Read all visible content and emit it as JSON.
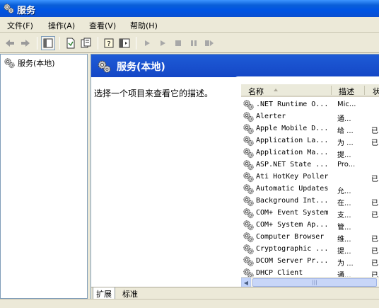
{
  "window": {
    "title": "服务"
  },
  "menu": [
    "文件(F)",
    "操作(A)",
    "查看(V)",
    "帮助(H)"
  ],
  "toolbar": {
    "buttons": [
      "back-icon",
      "forward-icon",
      "show-hide-tree-icon",
      "export-list-icon",
      "properties-icon",
      "help-icon",
      "console-tree-icon",
      "start-service-icon",
      "start-service-alt-icon",
      "stop-service-icon",
      "pause-service-icon",
      "restart-service-icon"
    ]
  },
  "tree": {
    "root_label": "服务(本地)"
  },
  "banner": {
    "title": "服务(本地)"
  },
  "description": {
    "text": "选择一个项目来查看它的描述。"
  },
  "list": {
    "columns": [
      "名称",
      "描述",
      "状"
    ],
    "rows": [
      {
        "name": ".NET Runtime O...",
        "desc": "Mic...",
        "status": ""
      },
      {
        "name": "Alerter",
        "desc": "通...",
        "status": ""
      },
      {
        "name": "Apple Mobile D...",
        "desc": "给 ...",
        "status": "已"
      },
      {
        "name": "Application La...",
        "desc": "为 ...",
        "status": "已"
      },
      {
        "name": "Application Ma...",
        "desc": "提...",
        "status": ""
      },
      {
        "name": "ASP.NET State ...",
        "desc": "Pro...",
        "status": ""
      },
      {
        "name": "Ati HotKey Poller",
        "desc": "",
        "status": "已"
      },
      {
        "name": "Automatic Updates",
        "desc": "允...",
        "status": ""
      },
      {
        "name": "Background Int...",
        "desc": "在...",
        "status": "已"
      },
      {
        "name": "COM+ Event System",
        "desc": "支...",
        "status": "已"
      },
      {
        "name": "COM+ System Ap...",
        "desc": "管...",
        "status": ""
      },
      {
        "name": "Computer Browser",
        "desc": "维...",
        "status": "已"
      },
      {
        "name": "Cryptographic ...",
        "desc": "提...",
        "status": "已"
      },
      {
        "name": "DCOM Server Pr...",
        "desc": "为 ...",
        "status": "已"
      },
      {
        "name": "DHCP Client",
        "desc": "通...",
        "status": "已"
      }
    ]
  },
  "tabs": [
    "扩展",
    "标准"
  ],
  "colors": {
    "title_bar": "#0054e3",
    "banner": "#1447c6",
    "window_bg": "#ece9d8"
  }
}
